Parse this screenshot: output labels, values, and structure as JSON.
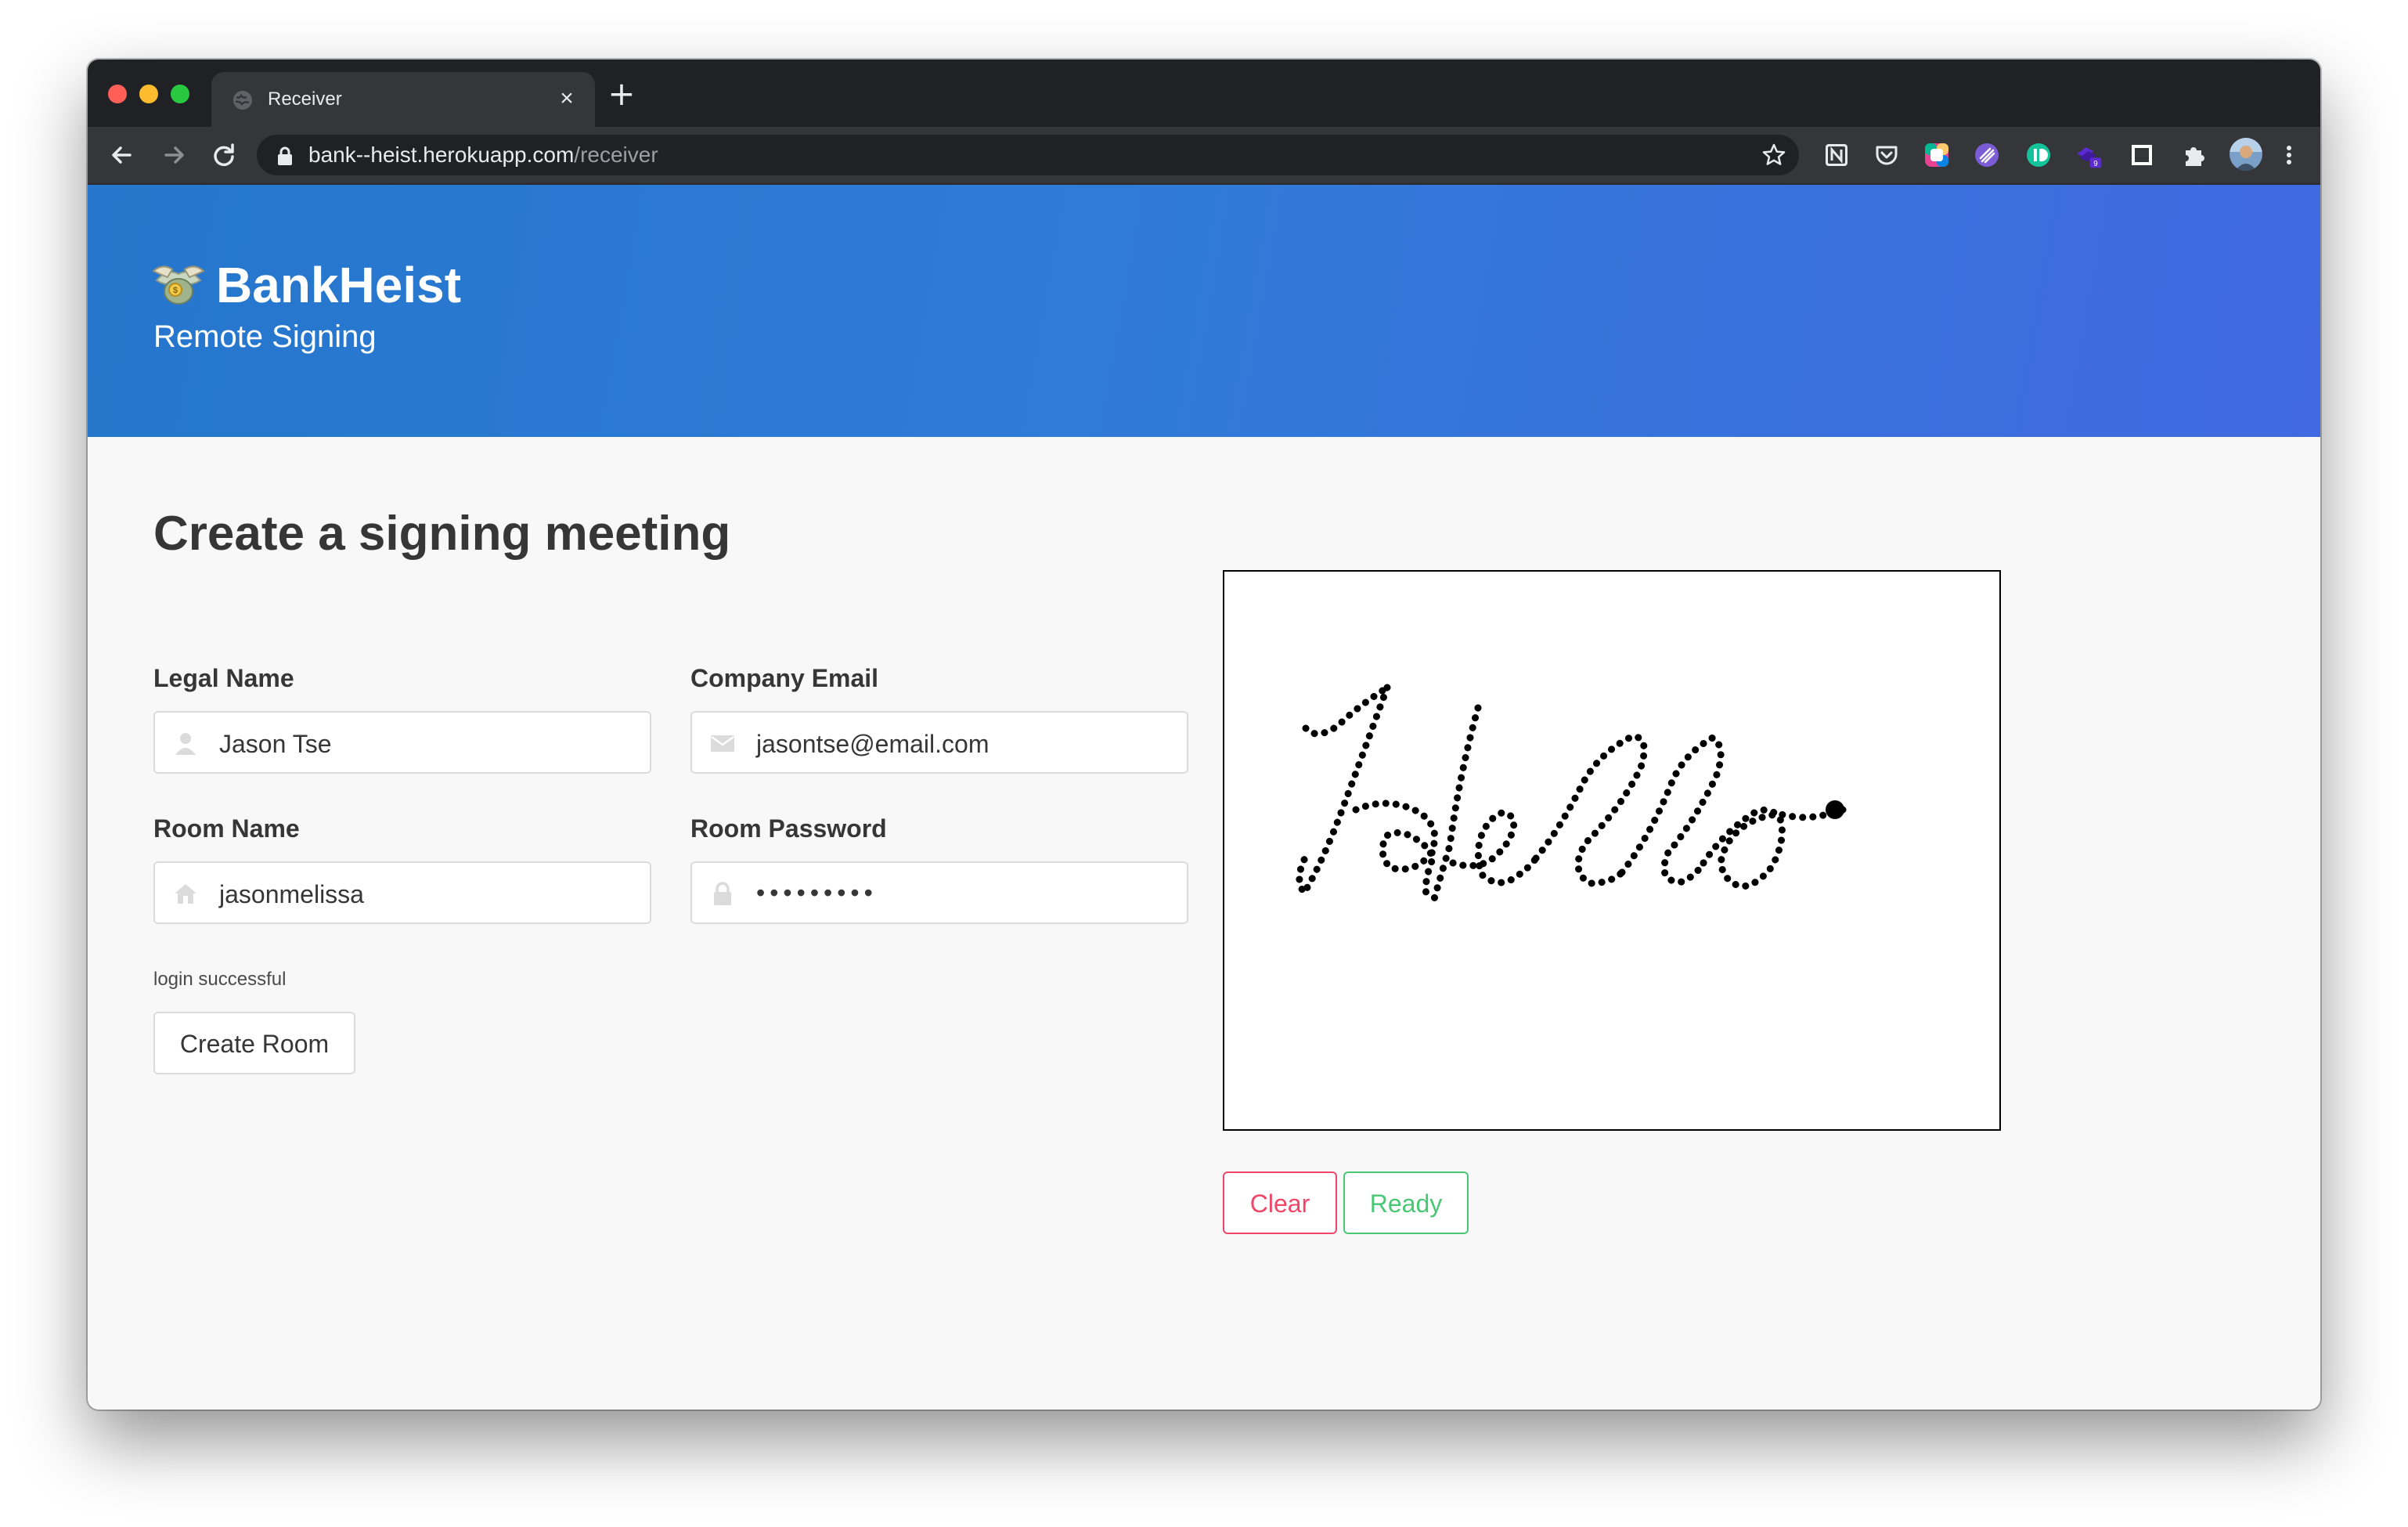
{
  "browser": {
    "tab_title": "Receiver",
    "url_host": "bank--heist.herokuapp.com",
    "url_path": "/receiver",
    "extensions": [
      "notion-icon",
      "pocket-icon",
      "color-picker-icon",
      "linear-icon",
      "grammar-icon",
      "stacked-tabs-icon",
      "square-icon",
      "puzzle-icon"
    ],
    "extension_badge": "9"
  },
  "header": {
    "title": "BankHeist",
    "subtitle": "Remote Signing"
  },
  "form": {
    "title": "Create a signing meeting",
    "legal_name": {
      "label": "Legal Name",
      "value": "Jason Tse"
    },
    "company_email": {
      "label": "Company Email",
      "value": "jasontse@email.com"
    },
    "room_name": {
      "label": "Room Name",
      "value": "jasonmelissa"
    },
    "room_password": {
      "label": "Room Password",
      "value": "•••••••••"
    },
    "status": "login successful",
    "create_button": "Create Room"
  },
  "signature": {
    "text": "Hello",
    "clear_button": "Clear",
    "ready_button": "Ready"
  },
  "colors": {
    "hero_start": "#2576cc",
    "hero_end": "#4169e1",
    "danger": "#f14668",
    "success": "#48c774"
  }
}
